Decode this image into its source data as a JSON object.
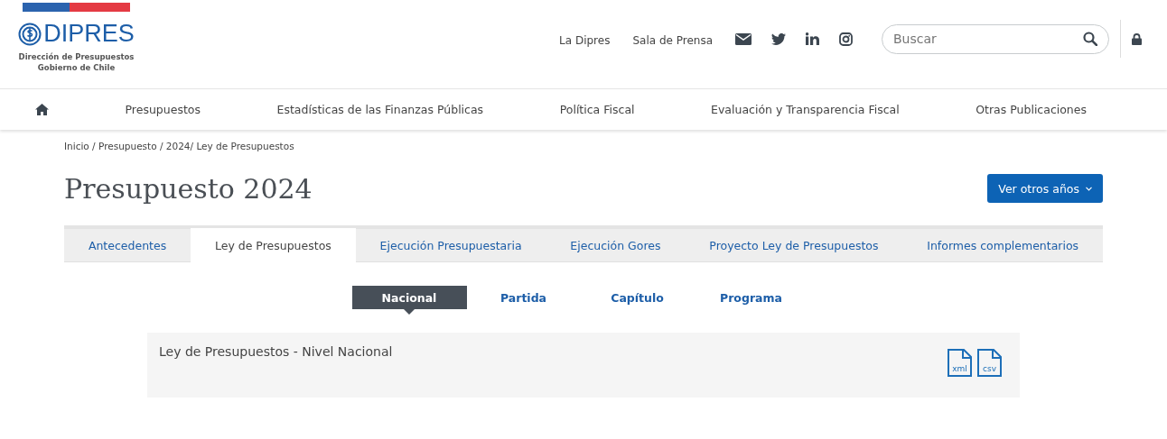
{
  "logo": {
    "wordmark": "DIPRES",
    "subtitle_1": "Dirección de Presupuestos",
    "subtitle_2": "Gobierno de Chile"
  },
  "top_links": [
    "La Dipres",
    "Sala de Prensa"
  ],
  "search": {
    "placeholder": "Buscar"
  },
  "nav": [
    "Presupuestos",
    "Estadísticas de las Finanzas Públicas",
    "Política Fiscal",
    "Evaluación y Transparencia Fiscal",
    "Otras Publicaciones"
  ],
  "breadcrumb": "Inicio / Presupuesto / 2024/ Ley de Presupuestos",
  "title": "Presupuesto 2024",
  "years_button": "Ver otros años",
  "tabs": [
    {
      "label": "Antecedentes",
      "selected": false
    },
    {
      "label": "Ley de Presupuestos",
      "selected": true
    },
    {
      "label": "Ejecución Presupuestaria",
      "selected": false
    },
    {
      "label": "Ejecución Gores",
      "selected": false
    },
    {
      "label": "Proyecto Ley de Presupuestos",
      "selected": false
    },
    {
      "label": "Informes complementarios",
      "selected": false
    }
  ],
  "subtabs": [
    {
      "label": "Nacional",
      "selected": true
    },
    {
      "label": "Partida",
      "selected": false
    },
    {
      "label": "Capítulo",
      "selected": false
    },
    {
      "label": "Programa",
      "selected": false
    }
  ],
  "panel": {
    "title": "Ley de Presupuestos - Nivel Nacional",
    "files": [
      "xml",
      "csv"
    ]
  }
}
